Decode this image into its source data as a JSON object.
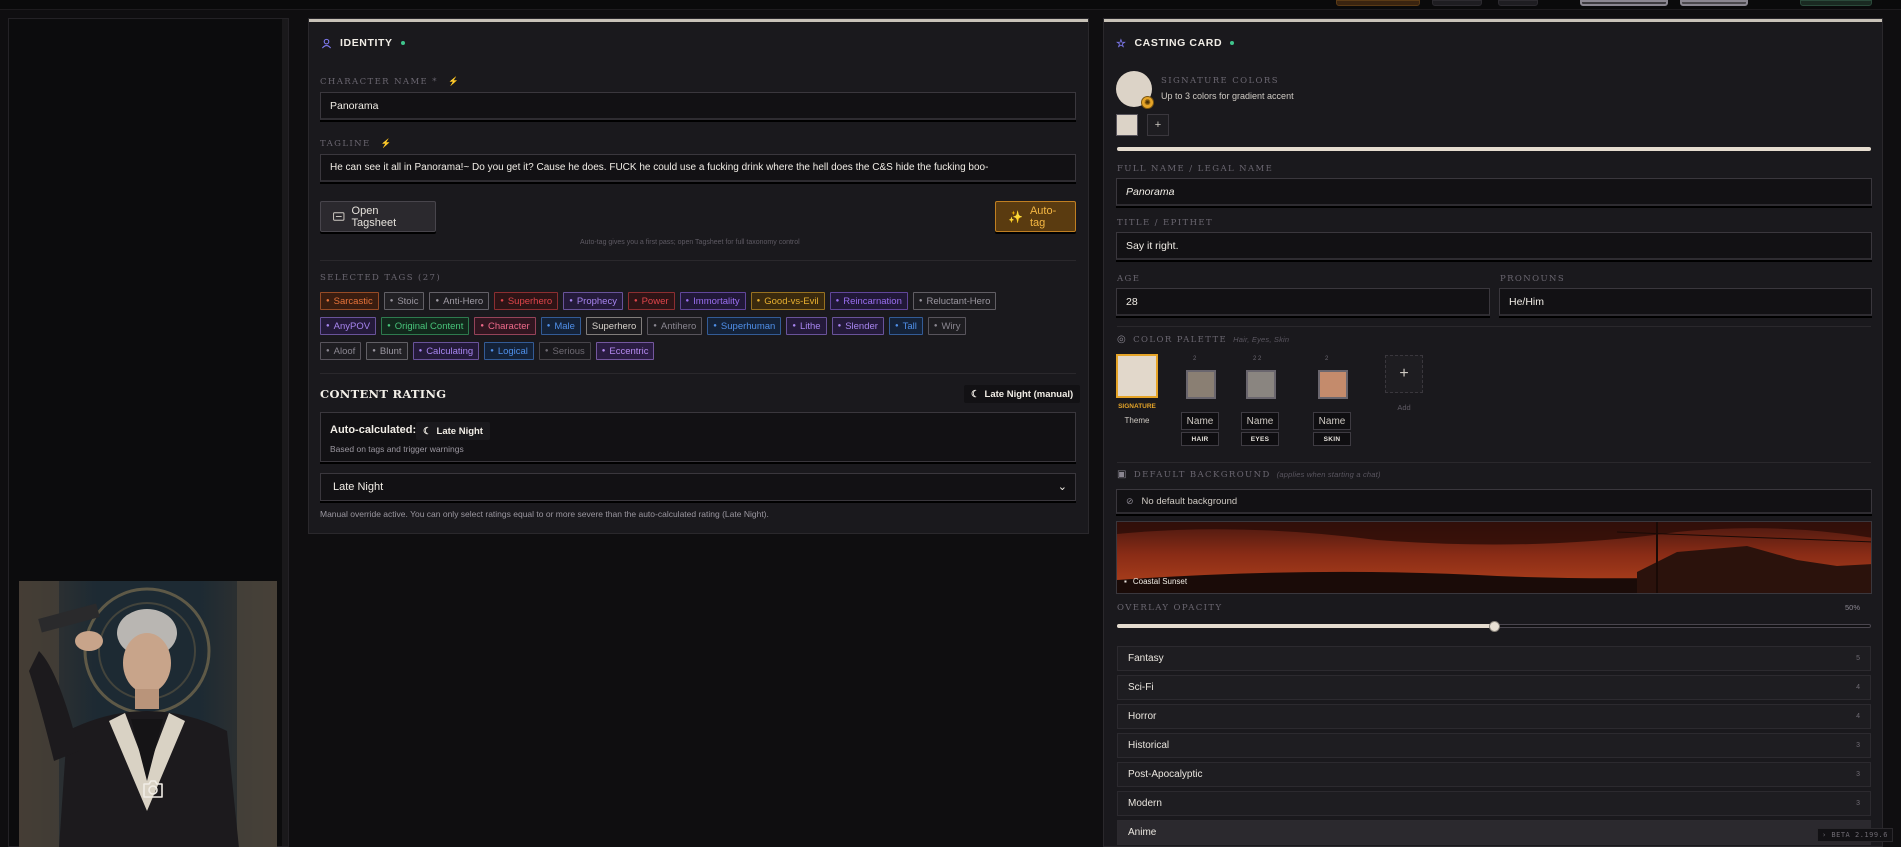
{
  "identity": {
    "title": "IDENTITY",
    "name_label": "Character Name *",
    "name_value": "Panorama",
    "tagline_label": "Tagline",
    "tagline_value": "He can see it all in Panorama!~ Do you get it? Cause he does. FUCK he could use a fucking drink where the hell does the C&S hide the fucking boo-",
    "open_tagsheet": "Open Tagsheet",
    "auto_tag": "Auto-tag",
    "auto_tag_hint": "Auto-tag gives you a first pass; open Tagsheet for full taxonomy control",
    "selected_tags_label": "Selected Tags (27)",
    "tag_rows": [
      [
        {
          "label": "Sarcastic",
          "icon": "flame",
          "color": "#e8743a",
          "bg": "#3a1d10"
        },
        {
          "label": "Stoic",
          "icon": "figure",
          "color": "#9b97a0",
          "bg": "#222125"
        },
        {
          "label": "Anti-Hero",
          "icon": "arc",
          "color": "#a09ca5",
          "bg": "#1e1d21"
        },
        {
          "label": "Superhero",
          "icon": "bolt",
          "color": "#e0454a",
          "bg": "#2e1416"
        },
        {
          "label": "Prophecy",
          "icon": "scroll",
          "color": "#a785ef",
          "bg": "#241a3a"
        },
        {
          "label": "Power",
          "icon": "bolt",
          "color": "#e0454a",
          "bg": "#2e1416"
        },
        {
          "label": "Immortality",
          "icon": "hourglass",
          "color": "#9a6ef0",
          "bg": "#211838"
        },
        {
          "label": "Good-vs-Evil",
          "icon": "yinyang",
          "color": "#e8b030",
          "bg": "#3a2a0e"
        },
        {
          "label": "Reincarnation",
          "icon": "cycle",
          "color": "#9a6ef0",
          "bg": "#211838"
        },
        {
          "label": "Reluctant-Hero",
          "icon": "cross",
          "color": "#9b97a0",
          "bg": "#1e1d21"
        }
      ],
      [
        {
          "label": "AnyPOV",
          "icon": "eye",
          "color": "#a785ef",
          "bg": "#241a3a"
        },
        {
          "label": "Original Content",
          "icon": "leaf",
          "color": "#48c37a",
          "bg": "#12281c"
        },
        {
          "label": "Character",
          "icon": "person",
          "color": "#ef6a8a",
          "bg": "#311620"
        },
        {
          "label": "Male",
          "icon": "male",
          "color": "#4f8fe8",
          "bg": "#142238"
        },
        {
          "label": "Superhero",
          "icon": "",
          "color": "#d7d2cb",
          "bg": "#1e1d21"
        },
        {
          "label": "Antihero",
          "icon": "gear",
          "color": "#8a8690",
          "bg": "#1e1d21"
        },
        {
          "label": "Superhuman",
          "icon": "dna",
          "color": "#4f8fe8",
          "bg": "#142238"
        },
        {
          "label": "Lithe",
          "icon": "feather",
          "color": "#a785ef",
          "bg": "#241a3a"
        },
        {
          "label": "Slender",
          "icon": "feather",
          "color": "#a785ef",
          "bg": "#241a3a"
        },
        {
          "label": "Tall",
          "icon": "ruler",
          "color": "#4f8fe8",
          "bg": "#142238"
        },
        {
          "label": "Wiry",
          "icon": "wire",
          "color": "#8a8690",
          "bg": "#1e1d21"
        }
      ],
      [
        {
          "label": "Aloof",
          "icon": "cloud",
          "color": "#8a8690",
          "bg": "#1e1d21"
        },
        {
          "label": "Blunt",
          "icon": "block",
          "color": "#9b97a0",
          "bg": "#222125"
        },
        {
          "label": "Calculating",
          "icon": "brain",
          "color": "#a785ef",
          "bg": "#241a3a"
        },
        {
          "label": "Logical",
          "icon": "brain",
          "color": "#4f8fe8",
          "bg": "#142238"
        },
        {
          "label": "Serious",
          "icon": "dash",
          "color": "#6e6a72",
          "bg": "#1a191d"
        },
        {
          "label": "Eccentric",
          "icon": "spark",
          "color": "#b58af0",
          "bg": "#2a1c42"
        }
      ]
    ],
    "content_rating_title": "CONTENT RATING",
    "rating_badge": "Late Night (manual)",
    "auto_calc_label": "Auto-calculated:",
    "auto_calc_value": "Late Night",
    "auto_calc_sub": "Based on tags and trigger warnings",
    "select_value": "Late Night",
    "override_note": "Manual override active. You can only select ratings equal to or more severe than the auto-calculated rating (Late Night)."
  },
  "casting": {
    "title": "CASTING CARD",
    "sig_label": "Signature Colors",
    "sig_sub": "Up to 3 colors for gradient accent",
    "sig_color": "#dcd3c7",
    "add_symbol": "+",
    "fullname_label": "Full Name / Legal Name",
    "fullname_value": "Panorama",
    "title_label": "Title / Epithet",
    "title_value": "Say it right.",
    "age_label": "Age",
    "age_value": "28",
    "pronouns_label": "Pronouns",
    "pronouns_value": "He/Him",
    "palette_label": "Color Palette",
    "palette_sub": "Hair, Eyes, Skin",
    "palette": {
      "signature_label": "SIGNATURE",
      "theme_label": "Theme",
      "signature_color": "#e2d8cb",
      "items": [
        {
          "color": "#8a7f73",
          "name": "Name",
          "tag": "HAIR",
          "dots": "2"
        },
        {
          "color": "#8a8580",
          "name": "Name",
          "tag": "EYES",
          "dots": "2 2"
        },
        {
          "color": "#c48b6c",
          "name": "Name",
          "tag": "SKIN",
          "dots": "2"
        }
      ],
      "add_label": "Add"
    },
    "bg_label": "Default Background",
    "bg_sub": "(applies when starting a chat)",
    "bg_none": "No default background",
    "bg_caption": "Coastal Sunset",
    "opacity_label": "Overlay Opacity",
    "opacity_value": "50%",
    "opacity_fraction": 0.5,
    "genres": [
      {
        "name": "Fantasy",
        "count": "5"
      },
      {
        "name": "Sci-Fi",
        "count": "4"
      },
      {
        "name": "Horror",
        "count": "4"
      },
      {
        "name": "Historical",
        "count": "3"
      },
      {
        "name": "Post-Apocalyptic",
        "count": "3"
      },
      {
        "name": "Modern",
        "count": "3"
      },
      {
        "name": "Anime",
        "count": ""
      }
    ]
  },
  "footer": {
    "beta": "› BETA 2.199.6"
  },
  "colors": {
    "accent_gold": "#e5a428",
    "accent_green": "#3fc58c",
    "panel": "#1a191d"
  }
}
